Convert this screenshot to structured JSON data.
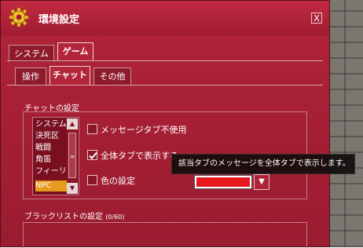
{
  "window": {
    "title": "環境設定",
    "close_label": "X"
  },
  "tabs_main": [
    {
      "label": "システム",
      "active": false
    },
    {
      "label": "ゲーム",
      "active": true
    }
  ],
  "tabs_sub": [
    {
      "label": "操作",
      "active": false
    },
    {
      "label": "チャット",
      "active": true
    },
    {
      "label": "その他",
      "active": false
    }
  ],
  "chat_settings": {
    "label": "チャットの設定",
    "channels": [
      "システム",
      "決死区",
      "戦闘",
      "角笛",
      "フィーリ",
      "NPC"
    ],
    "selected_channel": "NPC",
    "options": [
      {
        "label": "メッセージタブ不使用",
        "checked": false
      },
      {
        "label": "全体タブで表示する",
        "checked": true
      },
      {
        "label": "色の設定",
        "checked": false
      }
    ],
    "color_value": "#e8181e"
  },
  "tooltip": {
    "text": "該当タブのメッセージを全体タブで表示します。"
  },
  "blacklist": {
    "label": "ブラックリストの設定",
    "count": "(0/60)"
  },
  "colors": {
    "window_bg": "#a31e33",
    "accent": "#e79a1c"
  },
  "icons": [
    "gear-icon",
    "close-icon",
    "scroll-up-icon",
    "scroll-down-icon",
    "checkmark-icon",
    "dropdown-arrow-icon"
  ]
}
